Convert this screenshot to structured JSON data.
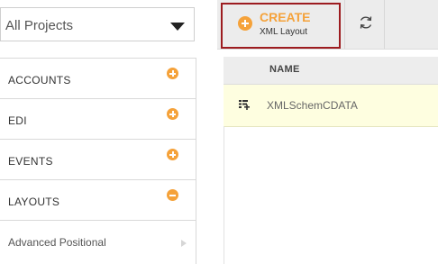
{
  "project_select": {
    "value": "All Projects"
  },
  "menu": {
    "items": [
      {
        "label": "ACCOUNTS",
        "state": "collapsed"
      },
      {
        "label": "EDI",
        "state": "collapsed"
      },
      {
        "label": "EVENTS",
        "state": "collapsed"
      },
      {
        "label": "LAYOUTS",
        "state": "expanded"
      }
    ],
    "sub_items": [
      {
        "label": "Advanced Positional"
      }
    ]
  },
  "toolbar": {
    "create_label": "CREATE",
    "create_sublabel": "XML Layout"
  },
  "grid": {
    "columns": [
      "NAME"
    ],
    "rows": [
      {
        "name": "XMLSchemCDATA"
      }
    ]
  },
  "colors": {
    "accent": "#f5a23a",
    "create_border": "#9d1c20",
    "selected_row": "#fefee0"
  }
}
